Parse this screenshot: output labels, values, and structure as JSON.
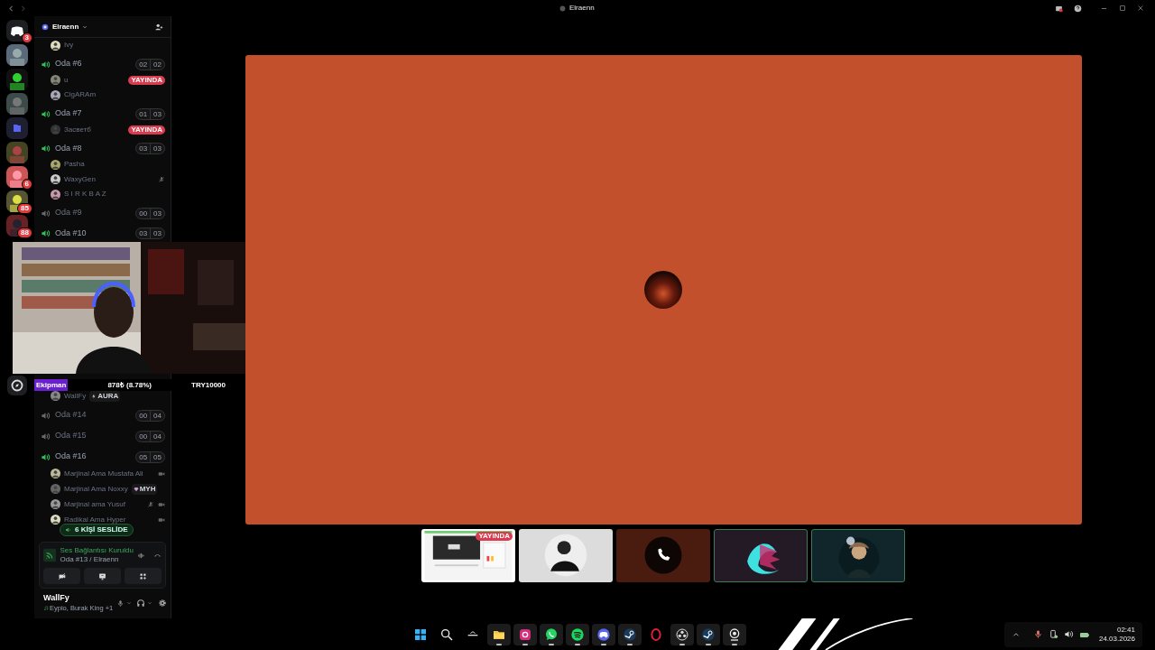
{
  "window": {
    "title": "Elraenn"
  },
  "servers": [
    {
      "kind": "logo",
      "badge": "3"
    },
    {
      "kind": "server"
    },
    {
      "kind": "server"
    },
    {
      "kind": "server"
    },
    {
      "kind": "folder"
    },
    {
      "kind": "server"
    },
    {
      "kind": "server",
      "badge": "6"
    },
    {
      "kind": "server",
      "badge": "85"
    },
    {
      "kind": "server",
      "badge": "88"
    },
    {
      "kind": "compass"
    }
  ],
  "server": {
    "name": "Elraenn"
  },
  "channels_top": [
    {
      "kind": "user",
      "name": "Ivy",
      "muted": false,
      "video": false
    },
    {
      "kind": "channel",
      "name": "Oda #6",
      "active": true,
      "count": "02",
      "limit": "02"
    },
    {
      "kind": "user",
      "name": "u",
      "live": "YAYINDA",
      "muted": false,
      "video": false
    },
    {
      "kind": "user",
      "name": "CigARAm",
      "muted": false,
      "video": false
    },
    {
      "kind": "channel",
      "name": "Oda #7",
      "active": true,
      "count": "01",
      "limit": "03"
    },
    {
      "kind": "user",
      "name": "Засветб",
      "live": "YAYINDA",
      "muted": false,
      "video": false
    },
    {
      "kind": "channel",
      "name": "Oda #8",
      "active": true,
      "count": "03",
      "limit": "03"
    },
    {
      "kind": "user",
      "name": "Pasha",
      "muted": false,
      "video": false
    },
    {
      "kind": "user",
      "name": "WaxyGen",
      "muted": true,
      "video": false
    },
    {
      "kind": "user",
      "name": "S I R K B A Z",
      "muted": false,
      "video": false
    },
    {
      "kind": "channel",
      "name": "Oda #9",
      "active": false,
      "count": "00",
      "limit": "03"
    },
    {
      "kind": "channel",
      "name": "Oda #10",
      "active": true,
      "count": "03",
      "limit": "03"
    }
  ],
  "channels_bottom": [
    {
      "kind": "user",
      "name": "WallFy",
      "tag": {
        "kind": "bolt",
        "text": "AURA"
      },
      "muted": false,
      "video": false
    },
    {
      "kind": "channel",
      "name": "Oda #14",
      "active": false,
      "count": "00",
      "limit": "04"
    },
    {
      "kind": "channel",
      "name": "Oda #15",
      "active": false,
      "count": "00",
      "limit": "04"
    },
    {
      "kind": "channel",
      "name": "Oda #16",
      "active": true,
      "count": "05",
      "limit": "05"
    },
    {
      "kind": "user",
      "name": "Marjinal Ama Mustafa Ali",
      "muted": false,
      "video": true
    },
    {
      "kind": "user",
      "name": "Marjinal Ama Noxxy",
      "tag": {
        "kind": "gem",
        "text": "MYH"
      },
      "muted": false,
      "video": false
    },
    {
      "kind": "user",
      "name": "Marjinal ama Yusuf",
      "muted": true,
      "video": true
    },
    {
      "kind": "user",
      "name": "Radikal Ama Hyper",
      "muted": false,
      "video": true
    }
  ],
  "voice_pill": "6 KİŞİ SESLİDE",
  "stream_overlay": {
    "label": "Ekipman",
    "amount": "878₺ (8.78%)",
    "goal": "TRY10000"
  },
  "voice_panel": {
    "status": "Ses Bağlantısı Kuruldu",
    "location": "Oda #13 / Elraenn"
  },
  "user_panel": {
    "name": "WallFy",
    "activity": "Eypio, Burak King +1"
  },
  "tiles": [
    {
      "kind": "stream",
      "live": "YAYINDA"
    },
    {
      "kind": "avatar"
    },
    {
      "kind": "call"
    },
    {
      "kind": "art"
    },
    {
      "kind": "portrait"
    }
  ],
  "taskbar": [
    {
      "kind": "start",
      "running": false
    },
    {
      "kind": "search",
      "running": false
    },
    {
      "kind": "widget",
      "running": false
    },
    {
      "kind": "files",
      "running": true
    },
    {
      "kind": "instagram",
      "running": true
    },
    {
      "kind": "whatsapp",
      "running": true
    },
    {
      "kind": "spotify",
      "running": true
    },
    {
      "kind": "discord",
      "running": true
    },
    {
      "kind": "steam",
      "running": true
    },
    {
      "kind": "opera",
      "running": false
    },
    {
      "kind": "obs",
      "running": true
    },
    {
      "kind": "steam",
      "running": true
    },
    {
      "kind": "camera",
      "running": true
    }
  ],
  "clock": {
    "time": "02:41",
    "date": "24.03.2026"
  }
}
